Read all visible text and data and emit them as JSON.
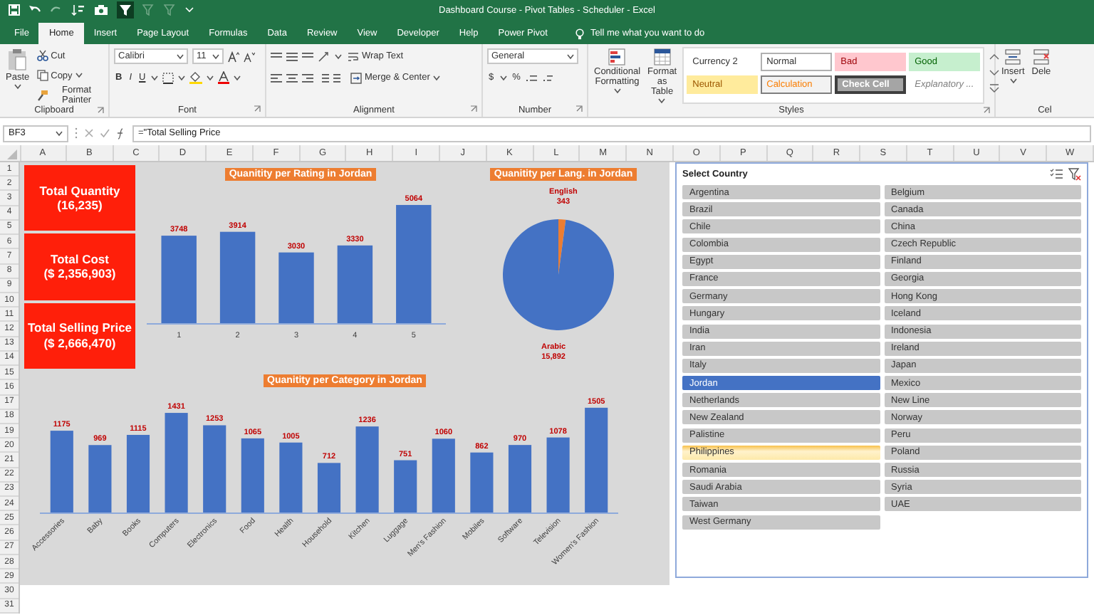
{
  "window": {
    "title": "Dashboard Course - Pivot Tables - Scheduler  -  Excel"
  },
  "ribbon_tabs": [
    {
      "label": "File",
      "selected": false
    },
    {
      "label": "Home",
      "selected": true
    },
    {
      "label": "Insert",
      "selected": false
    },
    {
      "label": "Page Layout",
      "selected": false
    },
    {
      "label": "Formulas",
      "selected": false
    },
    {
      "label": "Data",
      "selected": false
    },
    {
      "label": "Review",
      "selected": false
    },
    {
      "label": "View",
      "selected": false
    },
    {
      "label": "Developer",
      "selected": false
    },
    {
      "label": "Help",
      "selected": false
    },
    {
      "label": "Power Pivot",
      "selected": false
    }
  ],
  "tell_me": {
    "label": "Tell me what you want to do"
  },
  "ribbon": {
    "clipboard": {
      "label": "Clipboard",
      "paste": "Paste",
      "cut": "Cut",
      "copy": "Copy",
      "format_painter": "Format Painter"
    },
    "font": {
      "label": "Font",
      "font_name": "Calibri",
      "font_size": "11",
      "bold": "B",
      "italic": "I",
      "underline": "U"
    },
    "alignment": {
      "label": "Alignment",
      "wrap_text": "Wrap Text",
      "merge_center": "Merge & Center"
    },
    "number": {
      "label": "Number",
      "format": "General",
      "currency": "$",
      "percent": "%"
    },
    "styles": {
      "label": "Styles",
      "conditional_formatting": "Conditional Formatting",
      "format_as_table": "Format as Table",
      "cell_styles": [
        {
          "label": "Currency 2",
          "kind": "plain"
        },
        {
          "label": "Normal",
          "kind": "normal"
        },
        {
          "label": "Bad",
          "kind": "bad"
        },
        {
          "label": "Good",
          "kind": "good"
        },
        {
          "label": "Neutral",
          "kind": "neutral"
        },
        {
          "label": "Calculation",
          "kind": "calculation"
        },
        {
          "label": "Check Cell",
          "kind": "check"
        },
        {
          "label": "Explanatory ...",
          "kind": "explanatory"
        }
      ]
    },
    "cells": {
      "label": "Cel",
      "insert": "Insert",
      "delete": "Dele"
    }
  },
  "formula_bar": {
    "name_box": "BF3",
    "formula": "=\"Total Selling Price"
  },
  "columns": [
    "A",
    "B",
    "C",
    "D",
    "E",
    "F",
    "G",
    "H",
    "I",
    "J",
    "K",
    "L",
    "M",
    "N",
    "O",
    "P",
    "Q",
    "R",
    "S",
    "T",
    "U",
    "V",
    "W"
  ],
  "rows": [
    "1",
    "2",
    "3",
    "4",
    "5",
    "6",
    "7",
    "8",
    "9",
    "10",
    "11",
    "12",
    "13",
    "14",
    "15",
    "16",
    "17",
    "18",
    "19",
    "20",
    "21",
    "22",
    "23",
    "24",
    "25",
    "26",
    "27",
    "28",
    "29",
    "30",
    "31"
  ],
  "kpis": [
    {
      "title": "Total Quantity",
      "value": "(16,235)"
    },
    {
      "title": "Total Cost",
      "value": "($ 2,356,903)"
    },
    {
      "title": "Total Selling Price",
      "value": "($ 2,666,470)"
    }
  ],
  "rating_chart": {
    "chart_data": {
      "type": "bar",
      "title": "Quanitity per Rating in Jordan",
      "categories": [
        "1",
        "2",
        "3",
        "4",
        "5"
      ],
      "values": [
        3748,
        3914,
        3030,
        3330,
        5064
      ],
      "data_labels": true
    }
  },
  "language_chart": {
    "chart_data": {
      "type": "pie",
      "title": "Quanitity per Lang. in Jordan",
      "categories": [
        "English",
        "Arabic"
      ],
      "values": [
        343,
        15892
      ],
      "value_labels": [
        "343",
        "15,892"
      ]
    }
  },
  "category_chart": {
    "chart_data": {
      "type": "bar",
      "title": "Quanitity per Category in Jordan",
      "categories": [
        "Accessories",
        "Baby",
        "Books",
        "Computers",
        "Electronics",
        "Food",
        "Health",
        "Household",
        "Kitchen",
        "Luggage",
        "Men's Fashion",
        "Mobiles",
        "Software",
        "Television",
        "Women's Fashion"
      ],
      "values": [
        1175,
        969,
        1115,
        1431,
        1253,
        1065,
        1005,
        712,
        1236,
        751,
        1060,
        862,
        970,
        1078,
        1505
      ],
      "data_labels": true
    }
  },
  "slicer": {
    "title": "Select Country",
    "items": [
      {
        "label": "Argentina",
        "selected": false,
        "hovered": false
      },
      {
        "label": "Belgium",
        "selected": false,
        "hovered": false
      },
      {
        "label": "Brazil",
        "selected": false,
        "hovered": false
      },
      {
        "label": "Canada",
        "selected": false,
        "hovered": false
      },
      {
        "label": "Chile",
        "selected": false,
        "hovered": false
      },
      {
        "label": "China",
        "selected": false,
        "hovered": false
      },
      {
        "label": "Colombia",
        "selected": false,
        "hovered": false
      },
      {
        "label": "Czech Republic",
        "selected": false,
        "hovered": false
      },
      {
        "label": "Egypt",
        "selected": false,
        "hovered": false
      },
      {
        "label": "Finland",
        "selected": false,
        "hovered": false
      },
      {
        "label": "France",
        "selected": false,
        "hovered": false
      },
      {
        "label": "Georgia",
        "selected": false,
        "hovered": false
      },
      {
        "label": "Germany",
        "selected": false,
        "hovered": false
      },
      {
        "label": "Hong Kong",
        "selected": false,
        "hovered": false
      },
      {
        "label": "Hungary",
        "selected": false,
        "hovered": false
      },
      {
        "label": "Iceland",
        "selected": false,
        "hovered": false
      },
      {
        "label": "India",
        "selected": false,
        "hovered": false
      },
      {
        "label": "Indonesia",
        "selected": false,
        "hovered": false
      },
      {
        "label": "Iran",
        "selected": false,
        "hovered": false
      },
      {
        "label": "Ireland",
        "selected": false,
        "hovered": false
      },
      {
        "label": "Italy",
        "selected": false,
        "hovered": false
      },
      {
        "label": "Japan",
        "selected": false,
        "hovered": false
      },
      {
        "label": "Jordan",
        "selected": true,
        "hovered": false
      },
      {
        "label": "Mexico",
        "selected": false,
        "hovered": false
      },
      {
        "label": "Netherlands",
        "selected": false,
        "hovered": false
      },
      {
        "label": "New Line",
        "selected": false,
        "hovered": false
      },
      {
        "label": "New Zealand",
        "selected": false,
        "hovered": false
      },
      {
        "label": "Norway",
        "selected": false,
        "hovered": false
      },
      {
        "label": "Palistine",
        "selected": false,
        "hovered": false
      },
      {
        "label": "Peru",
        "selected": false,
        "hovered": false
      },
      {
        "label": "Philippines",
        "selected": false,
        "hovered": true
      },
      {
        "label": "Poland",
        "selected": false,
        "hovered": false
      },
      {
        "label": "Romania",
        "selected": false,
        "hovered": false
      },
      {
        "label": "Russia",
        "selected": false,
        "hovered": false
      },
      {
        "label": "Saudi Arabia",
        "selected": false,
        "hovered": false
      },
      {
        "label": "Syria",
        "selected": false,
        "hovered": false
      },
      {
        "label": "Taiwan",
        "selected": false,
        "hovered": false
      },
      {
        "label": "UAE",
        "selected": false,
        "hovered": false
      },
      {
        "label": "West Germany",
        "selected": false,
        "hovered": false
      }
    ]
  }
}
